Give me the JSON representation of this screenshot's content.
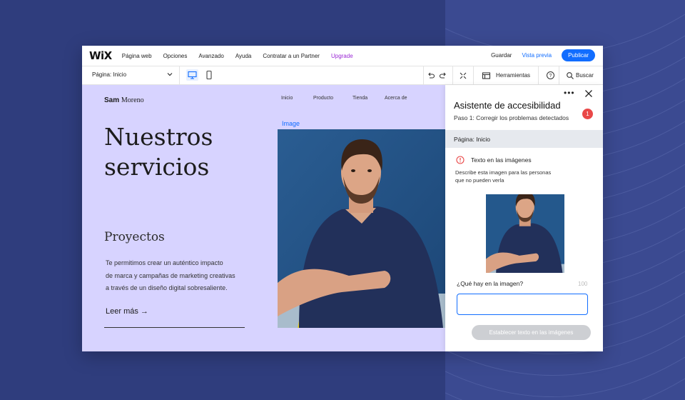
{
  "topbar": {
    "logo": "WiX",
    "menu": [
      "Página web",
      "Opciones",
      "Avanzado",
      "Ayuda",
      "Contratar a un Partner"
    ],
    "upgrade": "Upgrade",
    "save": "Guardar",
    "preview": "Vista previa",
    "publish": "Publicar"
  },
  "subbar": {
    "page_select": "Página:  Inicio",
    "tools": "Herramientas",
    "search": "Buscar"
  },
  "site": {
    "brand_first": "Sam",
    "brand_last": "Moreno",
    "nav": [
      "Inicio",
      "Producto",
      "Tienda",
      "Acerca de"
    ],
    "image_tag": "Image",
    "hero_line1": "Nuestros",
    "hero_line2": "servicios",
    "subtitle": "Proyectos",
    "body_line1": "Te permitimos crear un auténtico impacto",
    "body_line2": "de marca y campañas de marketing creativas",
    "body_line3": "a través de un diseño digital sobresaliente.",
    "read_more": "Leer más →"
  },
  "panel": {
    "title": "Asistente de accesibilidad",
    "step": "Paso 1: Corregir los problemas detectados",
    "badge": "1",
    "page": "Página: Inicio",
    "issue_title": "Texto en las imágenes",
    "issue_desc_line1": "Describe esta imagen para las personas",
    "issue_desc_line2": "que no pueden verla",
    "question": "¿Qué hay en la imagen?",
    "counter": "100",
    "input_value": "",
    "button": "Establecer texto en las imágenes"
  },
  "colors": {
    "accent": "#116dff",
    "canvas_bg": "#d7d3ff",
    "upgrade": "#9a27d5",
    "error": "#e94848"
  }
}
